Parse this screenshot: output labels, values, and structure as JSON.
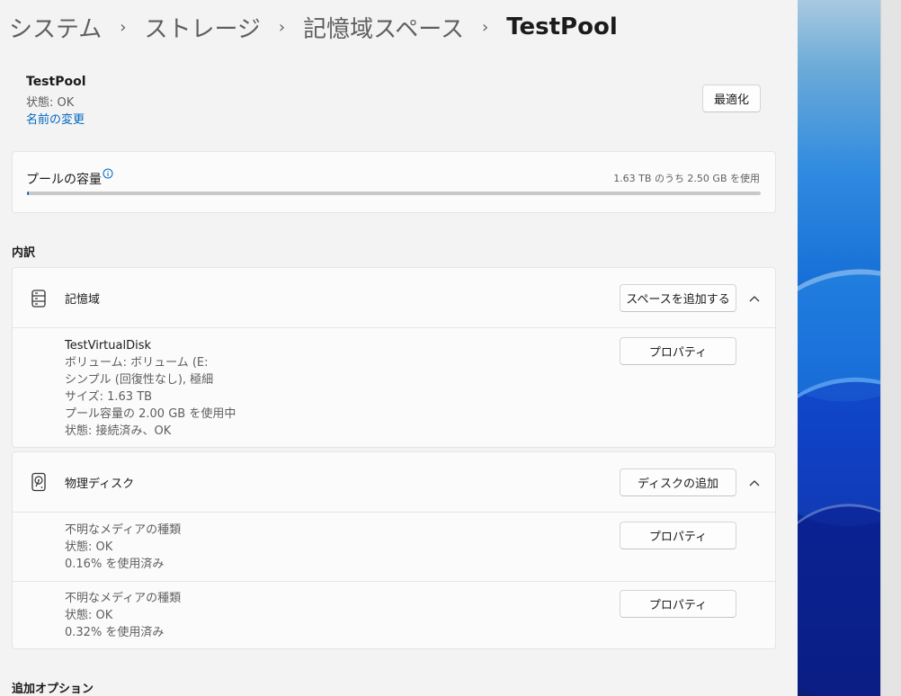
{
  "breadcrumb": [
    {
      "label": "システム"
    },
    {
      "label": "ストレージ"
    },
    {
      "label": "記憶域スペース"
    },
    {
      "label": "TestPool"
    }
  ],
  "breadcrumb_separator": "›",
  "pool": {
    "name": "TestPool",
    "status": "状態: OK",
    "rename_link": "名前の変更",
    "optimize_button": "最適化"
  },
  "capacity": {
    "label": "プールの容量",
    "usage_text": "1.63 TB のうち 2.50 GB を使用",
    "used_fraction": 0.0015,
    "info_icon": "info-icon"
  },
  "breakdown": {
    "title": "内訳",
    "storage": {
      "title": "記憶域",
      "icon": "storage-icon",
      "action_button": "スペースを追加する",
      "chevron": "chevron-up-icon",
      "items": [
        {
          "lines": [
            "TestVirtualDisk",
            "ボリューム: ボリューム (E:",
            "シンプル (回復性なし), 極細",
            "サイズ: 1.63 TB",
            "プール容量の 2.00 GB を使用中",
            "状態: 接続済み、OK"
          ],
          "button": "プロパティ"
        }
      ]
    },
    "physical": {
      "title": "物理ディスク",
      "icon": "hard-disk-icon",
      "action_button": "ディスクの追加",
      "chevron": "chevron-up-icon",
      "items": [
        {
          "lines": [
            "不明なメディアの種類",
            "状態: OK",
            "0.16% を使用済み"
          ],
          "button": "プロパティ"
        },
        {
          "lines": [
            "不明なメディアの種類",
            "状態: OK",
            "0.32% を使用済み"
          ],
          "button": "プロパティ"
        }
      ]
    }
  },
  "additional_options": {
    "title": "追加オプション"
  },
  "colors": {
    "accent": "#0067c0",
    "background": "#f3f3f3",
    "card": "#fbfbfb"
  }
}
